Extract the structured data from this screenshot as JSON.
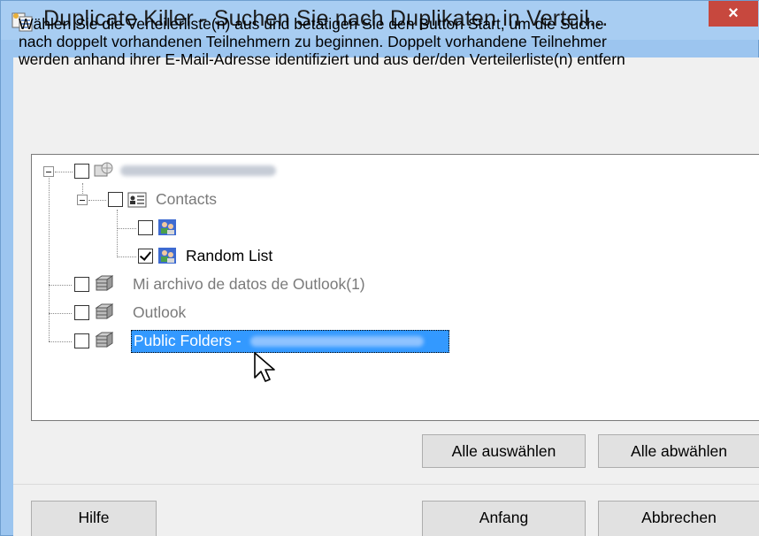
{
  "window": {
    "title": "Duplicate Killer - Suchen Sie nach Duplikaten in Verteil...",
    "close_symbol": "×"
  },
  "description": [
    "Wählen Sie die Verteilerliste(n) aus und betätigen Sie den Button Start, um die Suche",
    "nach doppelt vorhandenen Teilnehmern zu beginnen. Doppelt vorhandene Teilnehmer",
    "werden anhand ihrer E-Mail-Adresse identifiziert und aus der/den Verteilerliste(n) entfern"
  ],
  "tree": {
    "contacts_label": "Contacts",
    "random_list_label": "Random List",
    "archive_label": "Mi archivo de datos de Outlook(1)",
    "outlook_label": "Outlook",
    "public_folders_label": "Public Folders -",
    "random_list_checked": true
  },
  "buttons": {
    "select_all": "Alle auswählen",
    "deselect_all": "Alle abwählen",
    "help": "Hilfe",
    "start": "Anfang",
    "cancel": "Abbrechen"
  },
  "icons": {
    "app": "duplicate-killer-app-icon",
    "account": "account-globe-icon",
    "contacts": "contacts-card-icon",
    "distribution_list": "distribution-list-icon",
    "data_file": "outlook-data-file-icon",
    "cursor": "mouse-pointer-icon"
  },
  "colors": {
    "title_bar": "#a8cdf2",
    "close_button": "#c7483e",
    "selection": "#3399ff",
    "disabled_text": "#7a7a7a"
  }
}
